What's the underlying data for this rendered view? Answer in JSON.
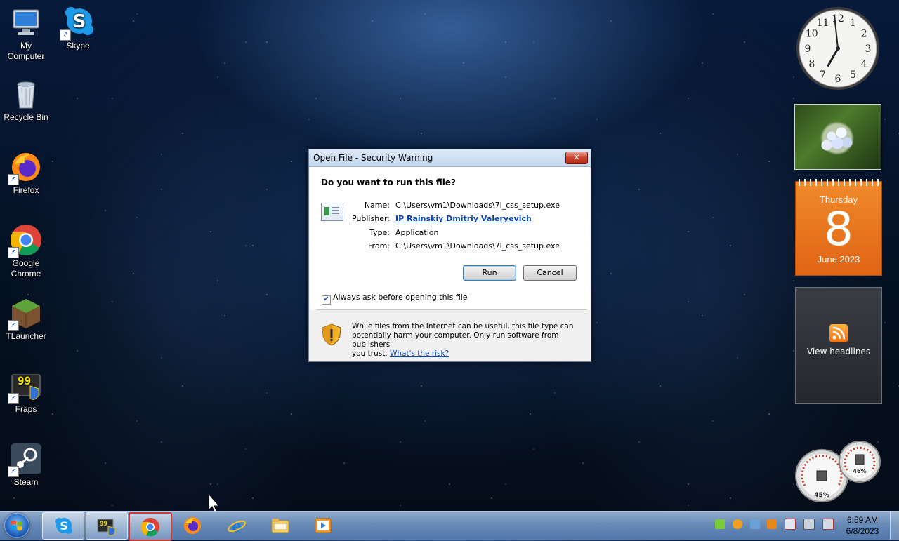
{
  "desktop": {
    "icons": [
      {
        "label": "My Computer"
      },
      {
        "label": "Skype"
      },
      {
        "label": "Recycle Bin"
      },
      {
        "label": "Firefox"
      },
      {
        "label": "Google Chrome"
      },
      {
        "label": "TLauncher"
      },
      {
        "label": "Fraps"
      },
      {
        "label": "Steam"
      }
    ]
  },
  "gadgets": {
    "clock": {
      "hour_numbers": [
        "12",
        "1",
        "2",
        "3",
        "4",
        "5",
        "6",
        "7",
        "8",
        "9",
        "10",
        "11"
      ],
      "time": "6:59"
    },
    "calendar": {
      "weekday": "Thursday",
      "day": "8",
      "month_year": "June 2023"
    },
    "feeds": {
      "label": "View headlines"
    },
    "meters": {
      "cpu_percent": "45%",
      "memory_percent": "46%"
    }
  },
  "dialog": {
    "title": "Open File - Security Warning",
    "close_label": "✕",
    "question": "Do you want to run this file?",
    "fields": {
      "name_label": "Name:",
      "name_value": "C:\\Users\\vm1\\Downloads\\7l_css_setup.exe",
      "publisher_label": "Publisher:",
      "publisher_value": "IP Rainskiy Dmitriy Valeryevich",
      "type_label": "Type:",
      "type_value": "Application",
      "from_label": "From:",
      "from_value": "C:\\Users\\vm1\\Downloads\\7l_css_setup.exe"
    },
    "run_button": "Run",
    "cancel_button": "Cancel",
    "checkbox_label": "Always ask before opening this file",
    "checkbox_checked": true,
    "warning_text_1": "While files from the Internet can be useful, this file type can",
    "warning_text_2": "potentially harm your computer. Only run software from publishers",
    "warning_text_3": "you trust.",
    "risk_link": "What's the risk?"
  },
  "taskbar": {
    "pinned": [
      "skype-icon",
      "fraps-icon",
      "chrome-icon",
      "firefox-icon",
      "internet-explorer-icon",
      "file-explorer-icon",
      "media-player-icon"
    ],
    "time": "6:59 AM",
    "date": "6/8/2023"
  },
  "colors": {
    "accent": "#0b46b3",
    "calendar": "#e8701c",
    "taskbar": "#8aaedb"
  }
}
